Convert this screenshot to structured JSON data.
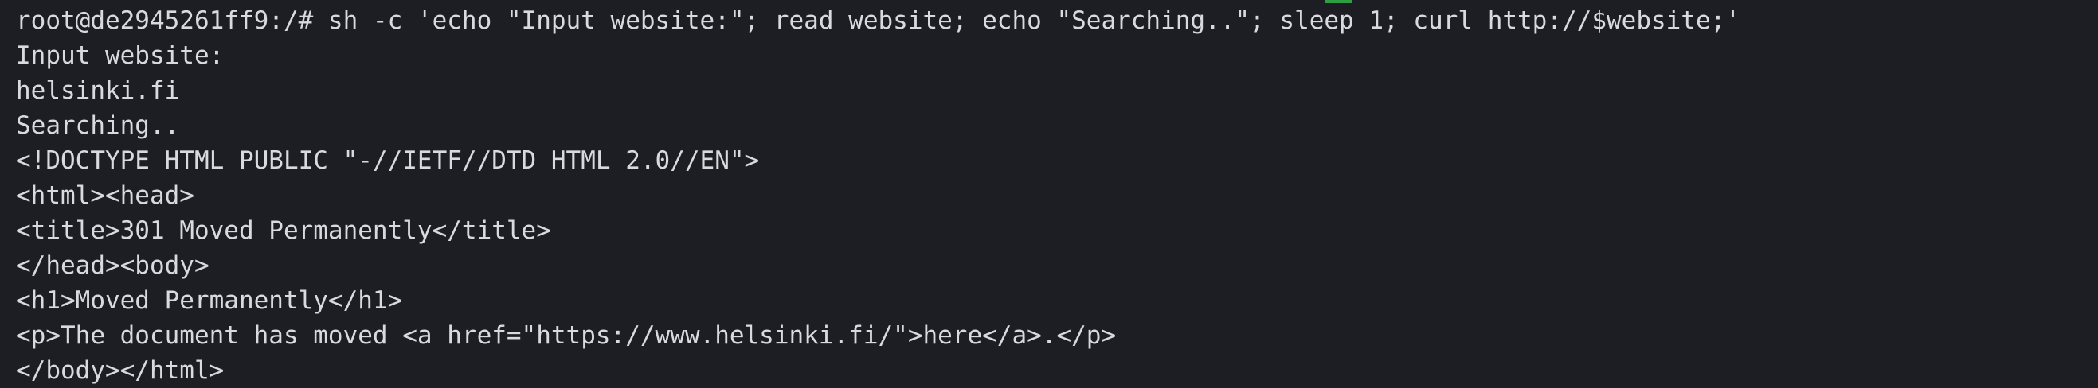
{
  "terminal": {
    "accent_color": "#2ea043",
    "lines": [
      "root@de2945261ff9:/# sh -c 'echo \"Input website:\"; read website; echo \"Searching..\"; sleep 1; curl http://$website;'",
      "Input website:",
      "helsinki.fi",
      "Searching..",
      "<!DOCTYPE HTML PUBLIC \"-//IETF//DTD HTML 2.0//EN\">",
      "<html><head>",
      "<title>301 Moved Permanently</title>",
      "</head><body>",
      "<h1>Moved Permanently</h1>",
      "<p>The document has moved <a href=\"https://www.helsinki.fi/\">here</a>.</p>",
      "</body></html>"
    ]
  }
}
